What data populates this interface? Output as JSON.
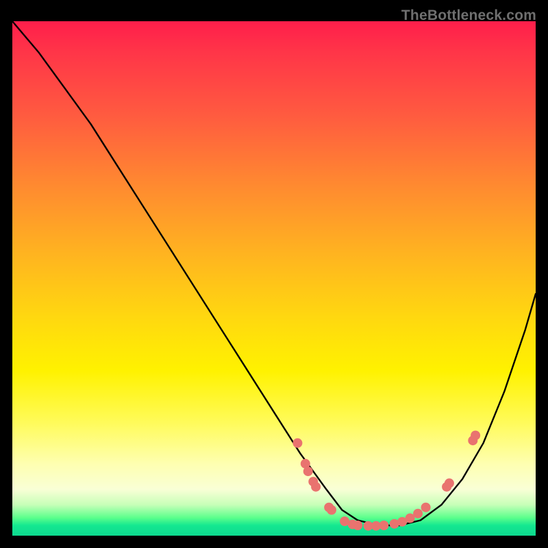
{
  "watermark": "TheBottleneck.com",
  "chart_data": {
    "type": "line",
    "title": "",
    "xlabel": "",
    "ylabel": "",
    "xlim": [
      0,
      100
    ],
    "ylim": [
      0,
      100
    ],
    "grid": false,
    "legend": false,
    "series": [
      {
        "name": "curve",
        "x": [
          0,
          5,
          10,
          15,
          20,
          25,
          30,
          35,
          40,
          45,
          50,
          55,
          60,
          63,
          66,
          70,
          74,
          78,
          82,
          86,
          90,
          94,
          98,
          100
        ],
        "y": [
          100,
          94,
          87,
          80,
          72,
          64,
          56,
          48,
          40,
          32,
          24,
          16,
          9,
          5,
          3,
          2,
          2,
          3,
          6,
          11,
          18,
          28,
          40,
          47
        ]
      }
    ],
    "markers": [
      {
        "x": 54.5,
        "y": 18.0
      },
      {
        "x": 56.0,
        "y": 14.0
      },
      {
        "x": 56.5,
        "y": 12.5
      },
      {
        "x": 57.5,
        "y": 10.5
      },
      {
        "x": 58.0,
        "y": 9.5
      },
      {
        "x": 60.5,
        "y": 5.5
      },
      {
        "x": 61.0,
        "y": 5.0
      },
      {
        "x": 63.5,
        "y": 2.8
      },
      {
        "x": 65.0,
        "y": 2.2
      },
      {
        "x": 66.0,
        "y": 2.0
      },
      {
        "x": 68.0,
        "y": 1.9
      },
      {
        "x": 69.5,
        "y": 1.9
      },
      {
        "x": 71.0,
        "y": 2.0
      },
      {
        "x": 73.0,
        "y": 2.3
      },
      {
        "x": 74.5,
        "y": 2.7
      },
      {
        "x": 76.0,
        "y": 3.4
      },
      {
        "x": 77.5,
        "y": 4.3
      },
      {
        "x": 79.0,
        "y": 5.5
      },
      {
        "x": 83.0,
        "y": 9.5
      },
      {
        "x": 83.5,
        "y": 10.2
      },
      {
        "x": 88.0,
        "y": 18.5
      },
      {
        "x": 88.5,
        "y": 19.5
      }
    ],
    "marker_style": {
      "color": "#e9736f",
      "radius_px": 7
    }
  }
}
